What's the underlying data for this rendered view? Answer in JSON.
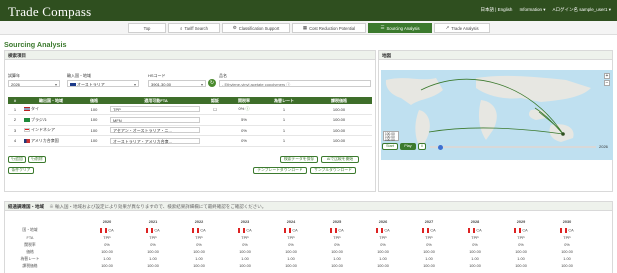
{
  "header": {
    "brand": "Trade Compass",
    "links": [
      "日本語 | English",
      "Information ▾",
      "Aログイン名 sample_user1 ▾"
    ]
  },
  "nav": {
    "tabs": [
      {
        "label": "Top",
        "icon": "",
        "active": false
      },
      {
        "label": "Tariff Search",
        "icon": "search-icon",
        "active": false
      },
      {
        "label": "Classification Support",
        "icon": "gear-icon",
        "active": false
      },
      {
        "label": "Cost Reduction Potential",
        "icon": "calculator-icon",
        "active": false
      },
      {
        "label": "Sourcing Analysis",
        "icon": "list-icon",
        "active": true
      },
      {
        "label": "Trade Analysis",
        "icon": "chart-icon",
        "active": false
      }
    ]
  },
  "page_title": "Sourcing Analysis",
  "search": {
    "panel_title": "検索項目",
    "year_label": "試算年",
    "year_value": "2026",
    "country_label": "輸入国・地域",
    "country_value": "オーストラリア",
    "hs_label": "HSコード",
    "hs_value": "3901.30.00",
    "product_label": "品名",
    "product_value": "- Ethylene-vinyl acetate copolymers ⓘ"
  },
  "table": {
    "headers": [
      "#",
      "輸出国・地域",
      "価格",
      "適用可能FTA",
      "認証",
      "関税率",
      "為替レート",
      "課税価格"
    ],
    "rows": [
      {
        "no": "1",
        "country": "タイ",
        "price": "100",
        "fta": "TPP",
        "cert": "",
        "rate": "0%",
        "fx": "1",
        "value": "100.00"
      },
      {
        "no": "2",
        "country": "ブラジル",
        "price": "100",
        "fta": "MFN",
        "cert": "",
        "rate": "5%",
        "fx": "1",
        "value": "100.00"
      },
      {
        "no": "3",
        "country": "インドネシア",
        "price": "100",
        "fta": "アセアン・オーストラリア・ニ...",
        "cert": "",
        "rate": "0%",
        "fx": "1",
        "value": "100.00"
      },
      {
        "no": "4",
        "country": "アメリカ合衆国",
        "price": "100",
        "fta": "オーストラリア・アメリカ合衆...",
        "cert": "",
        "rate": "0%",
        "fx": "1",
        "value": "100.00"
      }
    ]
  },
  "buttons": {
    "add_row": "行追加",
    "delete_row": "行削除",
    "clear": "条件クリア",
    "save_csv": "検索データを保存",
    "ai_analysis": "AIで比較を開始",
    "template_download": "テンプレートダウンロード",
    "sample_download": "サンプルダウンロード"
  },
  "map": {
    "title": "地図",
    "zoom_in": "+",
    "zoom_out": "−",
    "legend": [
      "100.00",
      "100.00",
      "100.00"
    ],
    "play_start": "Start",
    "play": "Play",
    "timeline_end": "2026"
  },
  "trend": {
    "title": "経過調達国・地域",
    "note": "※ 輸入国・地域および設定により効果が異なりますので、検索結果詳細欄にて最終確認をご確認ください。",
    "years": [
      "2020",
      "2021",
      "2022",
      "2023",
      "2024",
      "2025",
      "2026",
      "2027",
      "2028",
      "2029",
      "2030"
    ],
    "row_labels": [
      "国・地域",
      "FTA",
      "関税率",
      "価格",
      "為替レート",
      "課税価格"
    ],
    "country": "CA",
    "fta": "TPP",
    "rate": "0%",
    "price": "100.00",
    "fx": "1.00",
    "value": "100.00"
  },
  "colors": {
    "brand_green": "#3c7a2e",
    "header_dark": "#2f4f1f"
  }
}
